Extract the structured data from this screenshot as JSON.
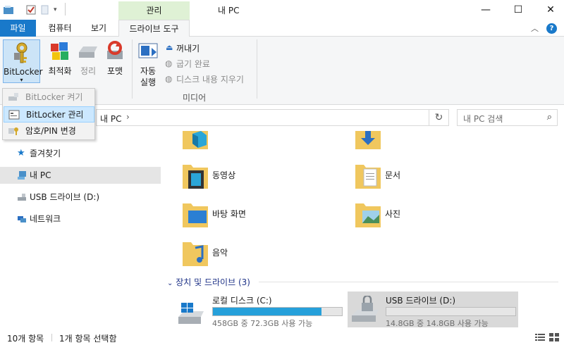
{
  "window": {
    "title": "내 PC",
    "context_tab": "관리",
    "minimize": "—",
    "maximize": "☐",
    "close": "✕"
  },
  "tabs": {
    "file": "파일",
    "computer": "컴퓨터",
    "view": "보기",
    "drive_tools": "드라이브 도구"
  },
  "ribbon": {
    "bitlocker": "BitLocker",
    "optimize": "최적화",
    "cleanup": "정리",
    "format": "포맷",
    "autoplay_line1": "자동",
    "autoplay_line2": "실행",
    "eject": "꺼내기",
    "burn": "굽기 완료",
    "erase": "디스크 내용 지우기",
    "group_media": "미디어"
  },
  "bitlocker_menu": [
    {
      "label": "BitLocker 켜기",
      "disabled": true
    },
    {
      "label": "BitLocker 관리",
      "disabled": false
    },
    {
      "label": "암호/PIN 변경",
      "disabled": false
    }
  ],
  "address": {
    "path": "내 PC",
    "chevron": "›",
    "refresh": "↻",
    "search_placeholder": "내 PC 검색"
  },
  "nav": {
    "quick_access": "즐겨찾기",
    "this_pc": "내 PC",
    "usb": "USB 드라이브 (D:)",
    "network": "네트워크"
  },
  "folders": [
    {
      "name": "",
      "icon": "3d-objects-folder-icon"
    },
    {
      "name": "",
      "icon": "downloads-folder-icon"
    },
    {
      "name": "동영상",
      "icon": "videos-folder-icon"
    },
    {
      "name": "문서",
      "icon": "documents-folder-icon"
    },
    {
      "name": "바탕 화면",
      "icon": "desktop-folder-icon"
    },
    {
      "name": "사진",
      "icon": "pictures-folder-icon"
    },
    {
      "name": "음악",
      "icon": "music-folder-icon"
    }
  ],
  "devices": {
    "header": "장치 및 드라이브 (3)",
    "items": [
      {
        "name": "로컬 디스크 (C:)",
        "free": "458GB 중 72.3GB 사용 가능",
        "used_fraction": 0.84,
        "selected": false
      },
      {
        "name": "USB 드라이브 (D:)",
        "free": "14.8GB 중 14.8GB 사용 가능",
        "used_fraction": 0.0,
        "selected": true
      }
    ]
  },
  "status": {
    "count": "10개 항목",
    "selected": "1개 항목 선택함"
  },
  "colors": {
    "accent": "#1979ca",
    "context_tab": "#dff1d5",
    "drive_bar": "#26a0da",
    "selection": "#cce8ff"
  }
}
